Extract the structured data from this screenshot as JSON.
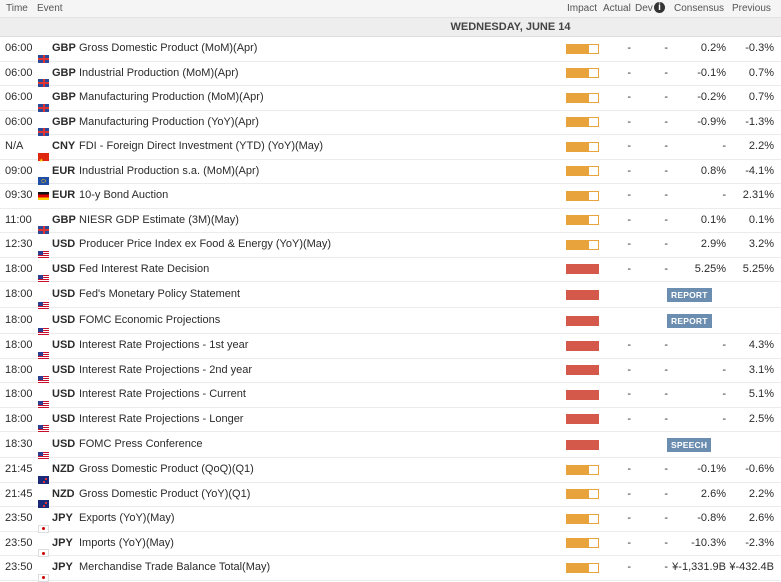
{
  "header": {
    "time": "Time",
    "event": "Event",
    "impact": "Impact",
    "actual": "Actual",
    "dev": "Dev",
    "consensus": "Consensus",
    "previous": "Previous",
    "info_icon": "i"
  },
  "day_label": "WEDNESDAY, JUNE 14",
  "colors": {
    "medium": "#e8a33c",
    "high": "#d4594a",
    "badge": "#6b8daf"
  },
  "rows": [
    {
      "time": "06:00",
      "ccy": "GBP",
      "flag": "gb-flag-icon",
      "event": "Gross Domestic Product (MoM)(Apr)",
      "impact": "medium",
      "actual": "-",
      "dev": "-",
      "consensus": "0.2%",
      "previous": "-0.3%"
    },
    {
      "time": "06:00",
      "ccy": "GBP",
      "flag": "gb-flag-icon",
      "event": "Industrial Production (MoM)(Apr)",
      "impact": "medium",
      "actual": "-",
      "dev": "-",
      "consensus": "-0.1%",
      "previous": "0.7%"
    },
    {
      "time": "06:00",
      "ccy": "GBP",
      "flag": "gb-flag-icon",
      "event": "Manufacturing Production (MoM)(Apr)",
      "impact": "medium",
      "actual": "-",
      "dev": "-",
      "consensus": "-0.2%",
      "previous": "0.7%"
    },
    {
      "time": "06:00",
      "ccy": "GBP",
      "flag": "gb-flag-icon",
      "event": "Manufacturing Production (YoY)(Apr)",
      "impact": "medium",
      "actual": "-",
      "dev": "-",
      "consensus": "-0.9%",
      "previous": "-1.3%"
    },
    {
      "time": "N/A",
      "ccy": "CNY",
      "flag": "cn-flag-icon",
      "event": "FDI - Foreign Direct Investment (YTD) (YoY)(May)",
      "impact": "medium",
      "actual": "-",
      "dev": "-",
      "consensus": "-",
      "previous": "2.2%"
    },
    {
      "time": "09:00",
      "ccy": "EUR",
      "flag": "eu-flag-icon",
      "event": "Industrial Production s.a. (MoM)(Apr)",
      "impact": "medium",
      "actual": "-",
      "dev": "-",
      "consensus": "0.8%",
      "previous": "-4.1%"
    },
    {
      "time": "09:30",
      "ccy": "EUR",
      "flag": "de-flag-icon",
      "event": "10-y Bond Auction",
      "impact": "medium",
      "actual": "-",
      "dev": "-",
      "consensus": "-",
      "previous": "2.31%"
    },
    {
      "time": "11:00",
      "ccy": "GBP",
      "flag": "gb-flag-icon",
      "event": "NIESR GDP Estimate (3M)(May)",
      "impact": "medium",
      "actual": "-",
      "dev": "-",
      "consensus": "0.1%",
      "previous": "0.1%"
    },
    {
      "time": "12:30",
      "ccy": "USD",
      "flag": "us-flag-icon",
      "event": "Producer Price Index ex Food & Energy (YoY)(May)",
      "impact": "medium",
      "actual": "-",
      "dev": "-",
      "consensus": "2.9%",
      "previous": "3.2%"
    },
    {
      "time": "18:00",
      "ccy": "USD",
      "flag": "us-flag-icon",
      "event": "Fed Interest Rate Decision",
      "impact": "high",
      "actual": "-",
      "dev": "-",
      "consensus": "5.25%",
      "previous": "5.25%"
    },
    {
      "time": "18:00",
      "ccy": "USD",
      "flag": "us-flag-icon",
      "event": "Fed's Monetary Policy Statement",
      "impact": "high",
      "badge": "REPORT",
      "tall": true
    },
    {
      "time": "18:00",
      "ccy": "USD",
      "flag": "us-flag-icon",
      "event": "FOMC Economic Projections",
      "impact": "high",
      "badge": "REPORT",
      "tall": true
    },
    {
      "time": "18:00",
      "ccy": "USD",
      "flag": "us-flag-icon",
      "event": "Interest Rate Projections - 1st year",
      "impact": "high",
      "actual": "-",
      "dev": "-",
      "consensus": "-",
      "previous": "4.3%"
    },
    {
      "time": "18:00",
      "ccy": "USD",
      "flag": "us-flag-icon",
      "event": "Interest Rate Projections - 2nd year",
      "impact": "high",
      "actual": "-",
      "dev": "-",
      "consensus": "-",
      "previous": "3.1%"
    },
    {
      "time": "18:00",
      "ccy": "USD",
      "flag": "us-flag-icon",
      "event": "Interest Rate Projections - Current",
      "impact": "high",
      "actual": "-",
      "dev": "-",
      "consensus": "-",
      "previous": "5.1%"
    },
    {
      "time": "18:00",
      "ccy": "USD",
      "flag": "us-flag-icon",
      "event": "Interest Rate Projections - Longer",
      "impact": "high",
      "actual": "-",
      "dev": "-",
      "consensus": "-",
      "previous": "2.5%"
    },
    {
      "time": "18:30",
      "ccy": "USD",
      "flag": "us-flag-icon",
      "event": "FOMC Press Conference",
      "impact": "high",
      "badge": "SPEECH",
      "tall": true
    },
    {
      "time": "21:45",
      "ccy": "NZD",
      "flag": "nz-flag-icon",
      "event": "Gross Domestic Product (QoQ)(Q1)",
      "impact": "medium",
      "actual": "-",
      "dev": "-",
      "consensus": "-0.1%",
      "previous": "-0.6%"
    },
    {
      "time": "21:45",
      "ccy": "NZD",
      "flag": "nz-flag-icon",
      "event": "Gross Domestic Product (YoY)(Q1)",
      "impact": "medium",
      "actual": "-",
      "dev": "-",
      "consensus": "2.6%",
      "previous": "2.2%"
    },
    {
      "time": "23:50",
      "ccy": "JPY",
      "flag": "jp-flag-icon",
      "event": "Exports (YoY)(May)",
      "impact": "medium",
      "actual": "-",
      "dev": "-",
      "consensus": "-0.8%",
      "previous": "2.6%"
    },
    {
      "time": "23:50",
      "ccy": "JPY",
      "flag": "jp-flag-icon",
      "event": "Imports (YoY)(May)",
      "impact": "medium",
      "actual": "-",
      "dev": "-",
      "consensus": "-10.3%",
      "previous": "-2.3%"
    },
    {
      "time": "23:50",
      "ccy": "JPY",
      "flag": "jp-flag-icon",
      "event": "Merchandise Trade Balance Total(May)",
      "impact": "medium",
      "actual": "-",
      "dev": "-",
      "consensus": "¥-1,331.9B",
      "previous": "¥-432.4B"
    }
  ]
}
